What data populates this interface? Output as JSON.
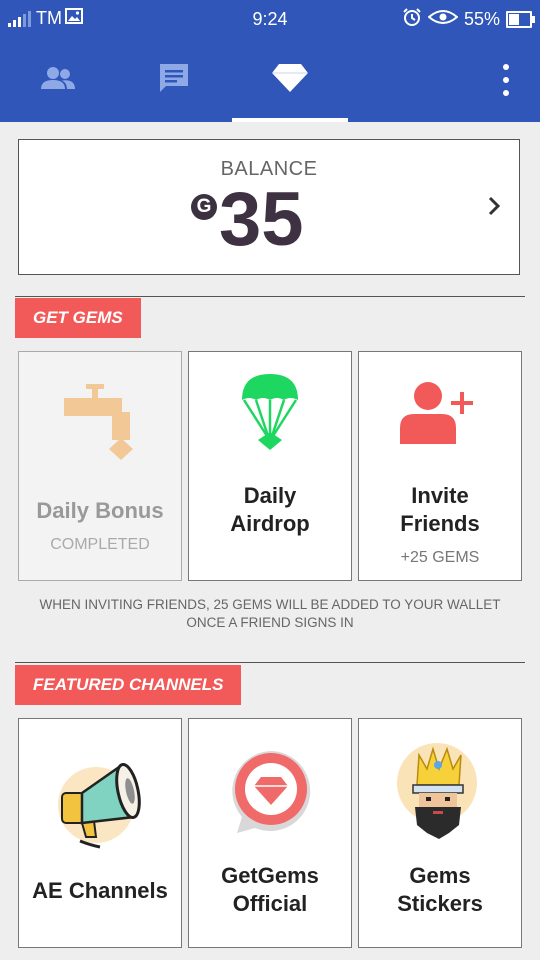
{
  "status_bar": {
    "carrier": "TM",
    "time": "9:24",
    "battery": "55%",
    "battery_level": 0.55,
    "icons": [
      "signal-icon",
      "image-icon",
      "alarm-icon",
      "eye-icon",
      "battery-icon"
    ]
  },
  "tabs": [
    {
      "name": "contacts",
      "icon": "people-icon",
      "active": false
    },
    {
      "name": "chats",
      "icon": "chat-icon",
      "active": false
    },
    {
      "name": "gems",
      "icon": "diamond-icon",
      "active": true
    }
  ],
  "balance": {
    "label": "BALANCE",
    "currency_symbol": "G",
    "value": "35"
  },
  "get_gems": {
    "section_label": "GET GEMS",
    "tiles": [
      {
        "title_line1": "Daily Bonus",
        "title_line2": "",
        "subtitle": "COMPLETED",
        "icon": "faucet-icon",
        "completed": true
      },
      {
        "title_line1": "Daily",
        "title_line2": "Airdrop",
        "subtitle": "",
        "icon": "parachute-gem-icon",
        "completed": false
      },
      {
        "title_line1": "Invite",
        "title_line2": "Friends",
        "subtitle": "+25 GEMS",
        "icon": "add-user-icon",
        "completed": false
      }
    ],
    "note_line1": "WHEN INVITING FRIENDS, 25 GEMS WILL BE ADDED TO YOUR WALLET",
    "note_line2": "ONCE A FRIEND SIGNS IN"
  },
  "featured": {
    "section_label": "FEATURED CHANNELS",
    "tiles": [
      {
        "title_line1": "AE Channels",
        "title_line2": "",
        "icon": "megaphone-icon"
      },
      {
        "title_line1": "GetGems",
        "title_line2": "Official",
        "icon": "getgems-logo-icon"
      },
      {
        "title_line1": "Gems",
        "title_line2": "Stickers",
        "icon": "king-sticker-icon"
      }
    ]
  },
  "colors": {
    "primary": "#2f56b8",
    "accent": "#f25a5a",
    "airdrop_green": "#1ed760",
    "faucet_tan": "#f2c896",
    "balance_text": "#3e3142"
  }
}
